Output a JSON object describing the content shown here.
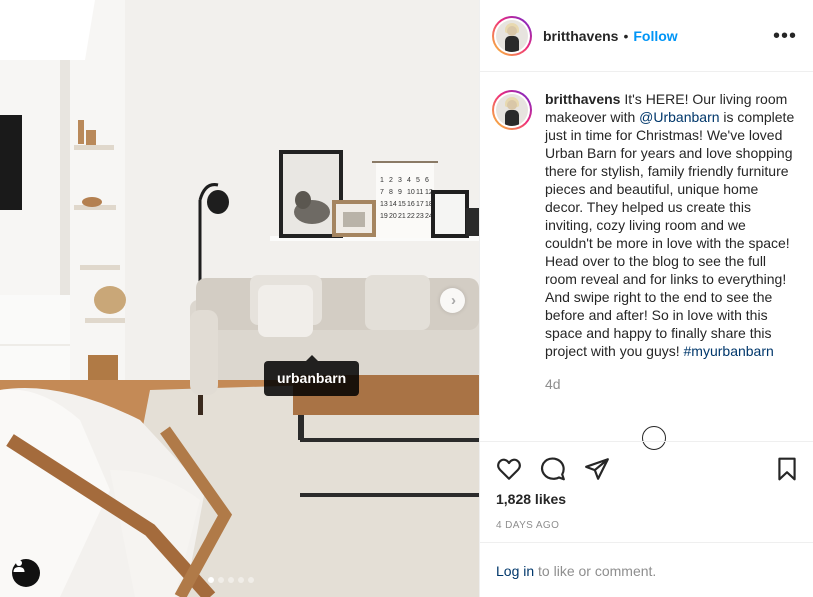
{
  "post": {
    "username": "britthavens",
    "follow_label": "Follow",
    "more_label": "•••",
    "caption_text_1": "It's HERE! Our living room makeover with ",
    "caption_mention": "@Urbanbarn",
    "caption_text_2": " is complete just in time for Christmas! We've loved Urban Barn for years and love shopping there for stylish, family friendly furniture pieces and beautiful, unique home decor. They helped us create this inviting, cozy living room and we couldn't be more in love with the space! Head over to the blog to see the full room reveal and for links to everything! And swipe right to the end to see the before and after! So in love with this space and happy to finally share this project with you guys!",
    "caption_hashtag": "#myurbanbarn",
    "caption_age": "4d",
    "likes": "1,828 likes",
    "date": "4 DAYS AGO",
    "login_label": "Log in",
    "login_suffix": " to like or comment."
  },
  "photo": {
    "tag_label": "urbanbarn",
    "calendar_numbers": [
      "1",
      "2",
      "3",
      "4",
      "5",
      "6",
      "7",
      "8",
      "9",
      "10",
      "11",
      "12",
      "13",
      "14",
      "15",
      "16",
      "17",
      "18",
      "19",
      "20",
      "21",
      "22",
      "23",
      "24"
    ],
    "carousel_total": 5,
    "carousel_index": 1
  },
  "icons": {
    "like": "heart-icon",
    "comment": "comment-bubble-icon",
    "share": "paper-plane-icon",
    "save": "bookmark-icon",
    "next": "chevron-right-icon",
    "user_tags": "person-icon",
    "more": "ellipsis-icon"
  },
  "colors": {
    "follow": "#0095f6",
    "link": "#00376b",
    "muted": "#8e8e8e",
    "text": "#262626"
  }
}
